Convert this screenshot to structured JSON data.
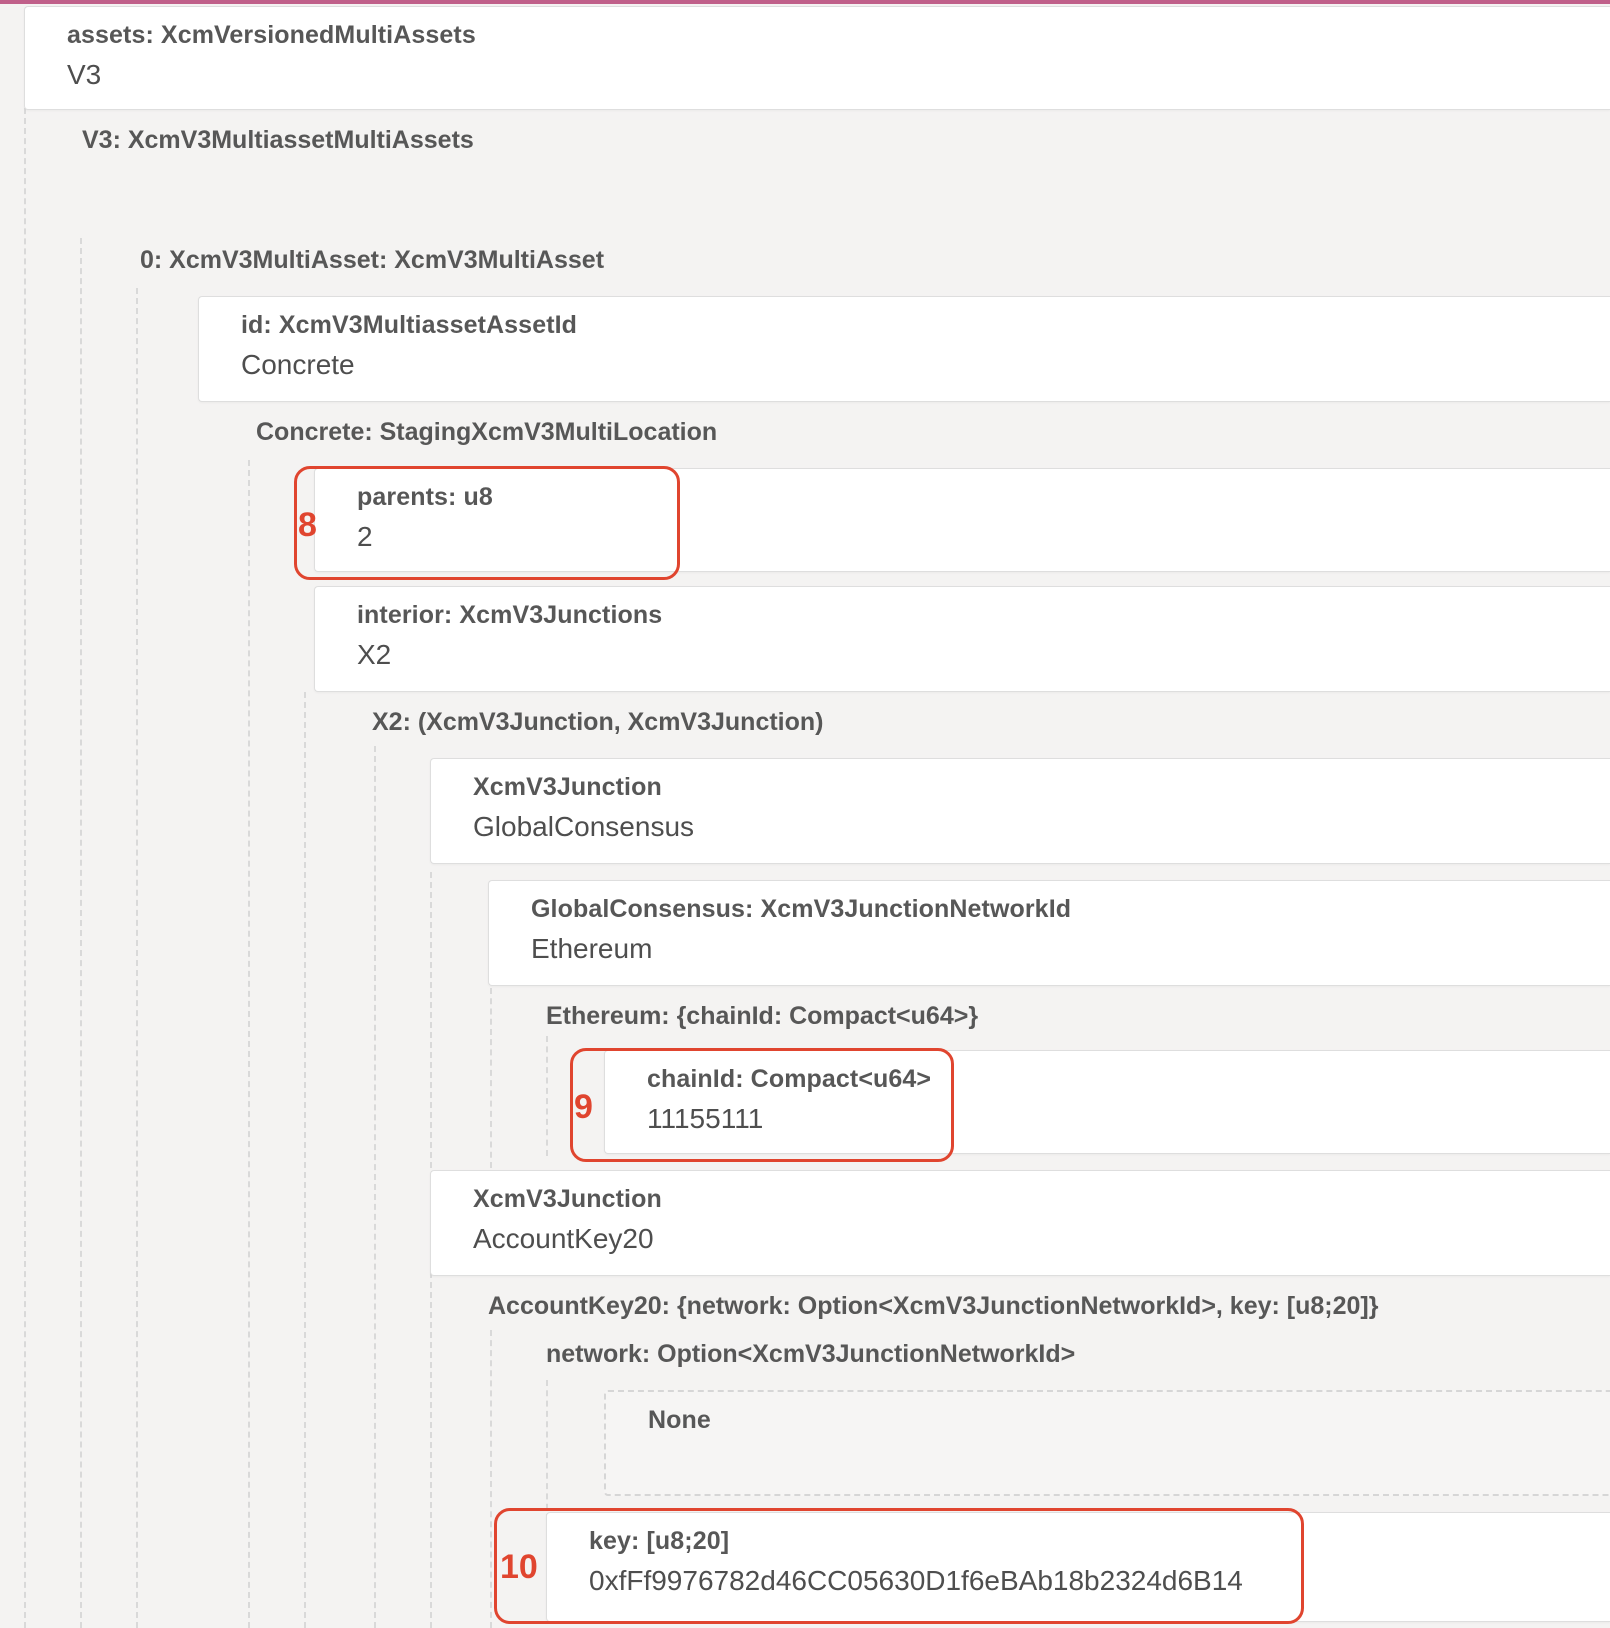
{
  "fields": {
    "assets": {
      "label": "assets: XcmVersionedMultiAssets",
      "value": "V3"
    },
    "v3_section": "V3: XcmV3MultiassetMultiAssets",
    "multiasset": "0: XcmV3MultiAsset: XcmV3MultiAsset",
    "id": {
      "label": "id: XcmV3MultiassetAssetId",
      "value": "Concrete"
    },
    "concrete": "Concrete: StagingXcmV3MultiLocation",
    "parents": {
      "label": "parents: u8",
      "value": "2"
    },
    "interior": {
      "label": "interior: XcmV3Junctions",
      "value": "X2"
    },
    "x2": "X2: (XcmV3Junction, XcmV3Junction)",
    "junction1": {
      "label": "XcmV3Junction",
      "value": "GlobalConsensus"
    },
    "global": {
      "label": "GlobalConsensus: XcmV3JunctionNetworkId",
      "value": "Ethereum"
    },
    "ethereum": "Ethereum: {chainId: Compact<u64>}",
    "chainid": {
      "label": "chainId: Compact<u64>",
      "value": "11155111"
    },
    "junction2": {
      "label": "XcmV3Junction",
      "value": "AccountKey20"
    },
    "accountkey20": "AccountKey20: {network: Option<XcmV3JunctionNetworkId>, key: [u8;20]}",
    "network": "network: Option<XcmV3JunctionNetworkId>",
    "none": {
      "label": "None"
    },
    "key": {
      "label": "key: [u8;20]",
      "value": "0xfFf9976782d46CC05630D1f6eBAb18b2324d6B14"
    }
  },
  "annotations": {
    "parents": "8",
    "chainid": "9",
    "key": "10"
  },
  "colors": {
    "highlight": "#e0452f",
    "background": "#f4f3f2",
    "card": "#ffffff"
  }
}
